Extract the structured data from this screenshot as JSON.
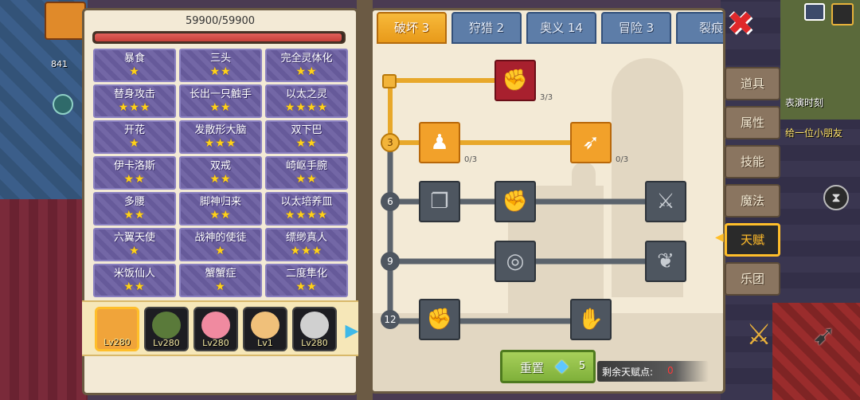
{
  "colors": {
    "accent": "#f2a12a",
    "tab_inactive": "#5d7da8",
    "grid_cell": "#6a5ea0",
    "hp": "#c8403a",
    "close": "#e0282a"
  },
  "background": {
    "player_level": "841",
    "right_title": "表演时刻",
    "right_message": "给一位小朋友",
    "badge_number": "5"
  },
  "left_panel": {
    "hp_text": "59900/59900",
    "hp_fraction": 1.0,
    "traits": [
      {
        "name": "暴食",
        "stars": "★"
      },
      {
        "name": "三头",
        "stars": "★★"
      },
      {
        "name": "完全灵体化",
        "stars": "★★"
      },
      {
        "name": "替身攻击",
        "stars": "★★★"
      },
      {
        "name": "长出一只触手",
        "stars": "★★"
      },
      {
        "name": "以太之灵",
        "stars": "★★★★"
      },
      {
        "name": "开花",
        "stars": "★"
      },
      {
        "name": "发散形大脑",
        "stars": "★★★"
      },
      {
        "name": "双下巴",
        "stars": "★★"
      },
      {
        "name": "伊卡洛斯",
        "stars": "★★"
      },
      {
        "name": "双戒",
        "stars": "★★"
      },
      {
        "name": "崎岖手腕",
        "stars": "★★"
      },
      {
        "name": "多腰",
        "stars": "★★"
      },
      {
        "name": "脚神归来",
        "stars": "★★"
      },
      {
        "name": "以太培养皿",
        "stars": "★★★★"
      },
      {
        "name": "六翼天使",
        "stars": "★"
      },
      {
        "name": "战神的使徒",
        "stars": "★"
      },
      {
        "name": "缥缈真人",
        "stars": "★★★"
      },
      {
        "name": "米饭仙人",
        "stars": "★★"
      },
      {
        "name": "蟹蟹症",
        "stars": "★"
      },
      {
        "name": "二度隼化",
        "stars": "★★"
      }
    ],
    "heroes": [
      {
        "level": "Lv280",
        "selected": true,
        "face": "#f0a43a"
      },
      {
        "level": "Lv280",
        "selected": false,
        "face": "#5a7a3a"
      },
      {
        "level": "Lv280",
        "selected": false,
        "face": "#f08aa0"
      },
      {
        "level": "Lv1",
        "selected": false,
        "face": "#f0c07a"
      },
      {
        "level": "Lv280",
        "selected": false,
        "face": "#d0d0d0"
      }
    ]
  },
  "talent_panel": {
    "tabs": [
      "破坏 3",
      "狩猎 2",
      "奥义 14",
      "冒险 3",
      "裂痕"
    ],
    "active_tab": 0,
    "tiers": [
      "3",
      "6",
      "9",
      "12"
    ],
    "nodes": [
      {
        "icon": "arm-wrestle-icon",
        "glyph": "✊",
        "state": "maxed",
        "count": "3/3"
      },
      {
        "icon": "muscle-body-icon",
        "glyph": "♟",
        "state": "unlocked",
        "count": "0/3"
      },
      {
        "icon": "arrow-strike-icon",
        "glyph": "➶",
        "state": "unlocked",
        "count": "0/3"
      },
      {
        "icon": "cards-icon",
        "glyph": "❐",
        "state": "locked",
        "count": ""
      },
      {
        "icon": "punch-icon",
        "glyph": "✊",
        "state": "locked",
        "count": ""
      },
      {
        "icon": "sword-slash-icon",
        "glyph": "⚔",
        "state": "locked",
        "count": ""
      },
      {
        "icon": "ripple-icon",
        "glyph": "◎",
        "state": "locked",
        "count": ""
      },
      {
        "icon": "bat-wing-icon",
        "glyph": "❦",
        "state": "locked",
        "count": ""
      },
      {
        "icon": "fist-icon",
        "glyph": "✊",
        "state": "locked",
        "count": ""
      },
      {
        "icon": "gauntlet-icon",
        "glyph": "✋",
        "state": "locked",
        "count": ""
      }
    ],
    "reset_label": "重置",
    "reset_cost": "5",
    "points_label": "剩余天赋点:",
    "points_value": "0"
  },
  "side_menu": {
    "items": [
      "道具",
      "属性",
      "技能",
      "魔法",
      "天赋",
      "乐团"
    ],
    "active": 4
  }
}
